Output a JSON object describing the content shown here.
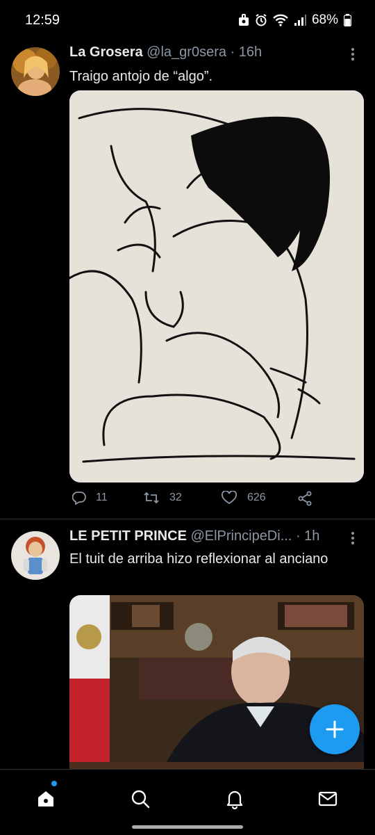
{
  "status_bar": {
    "time": "12:59",
    "battery": "68%"
  },
  "tweets": [
    {
      "name": "La Grosera",
      "handle": "@la_gr0sera",
      "separator": "·",
      "time": "16h",
      "text": "Traigo antojo de “algo”.",
      "replies": "11",
      "retweets": "32",
      "likes": "626"
    },
    {
      "name": "LE PETIT PRINCE",
      "handle": "@ElPrincipeDi...",
      "separator": "·",
      "time": "1h",
      "text": "El tuit de arriba hizo reflexionar al anciano"
    }
  ],
  "icons": {
    "home": "home-icon",
    "search": "search-icon",
    "notifications": "bell-icon",
    "messages": "mail-icon",
    "compose": "plus-icon"
  },
  "colors": {
    "accent": "#1d9bf0",
    "background": "#000000",
    "muted": "#8b98a5"
  }
}
